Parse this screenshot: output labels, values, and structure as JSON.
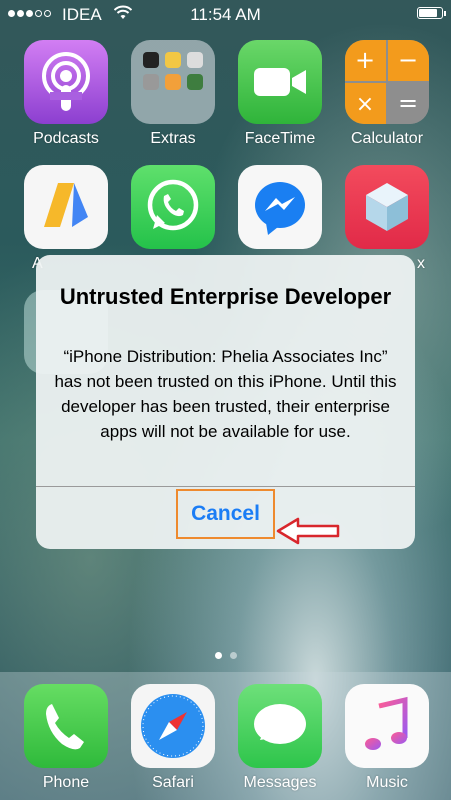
{
  "status_bar": {
    "carrier": "IDEA",
    "time": "11:54 AM",
    "signal_dots_filled": 3,
    "signal_dots_total": 5
  },
  "home": {
    "row1": [
      {
        "label": "Podcasts",
        "icon": "podcasts-icon"
      },
      {
        "label": "Extras",
        "icon": "folder-icon"
      },
      {
        "label": "FaceTime",
        "icon": "facetime-icon"
      },
      {
        "label": "Calculator",
        "icon": "calculator-icon"
      }
    ],
    "row2": [
      {
        "label": "A",
        "icon": "adsense-icon"
      },
      {
        "label": "",
        "icon": "whatsapp-icon"
      },
      {
        "label": "",
        "icon": "messenger-icon"
      },
      {
        "label": "x",
        "icon": "box-icon"
      }
    ],
    "page_count": 2,
    "active_page": 1
  },
  "dock": [
    {
      "label": "Phone",
      "icon": "phone-icon"
    },
    {
      "label": "Safari",
      "icon": "safari-icon"
    },
    {
      "label": "Messages",
      "icon": "messages-icon"
    },
    {
      "label": "Music",
      "icon": "music-icon"
    }
  ],
  "alert": {
    "title": "Untrusted Enterprise Developer",
    "message": "“iPhone Distribution: Phelia Associates Inc” has not been trusted on this iPhone. Until this developer has been trusted, their enterprise apps will not be available for use.",
    "cancel_label": "Cancel"
  },
  "colors": {
    "accent": "#1b7df5",
    "highlight": "#ee8a2e",
    "arrow": "#d8262c"
  }
}
